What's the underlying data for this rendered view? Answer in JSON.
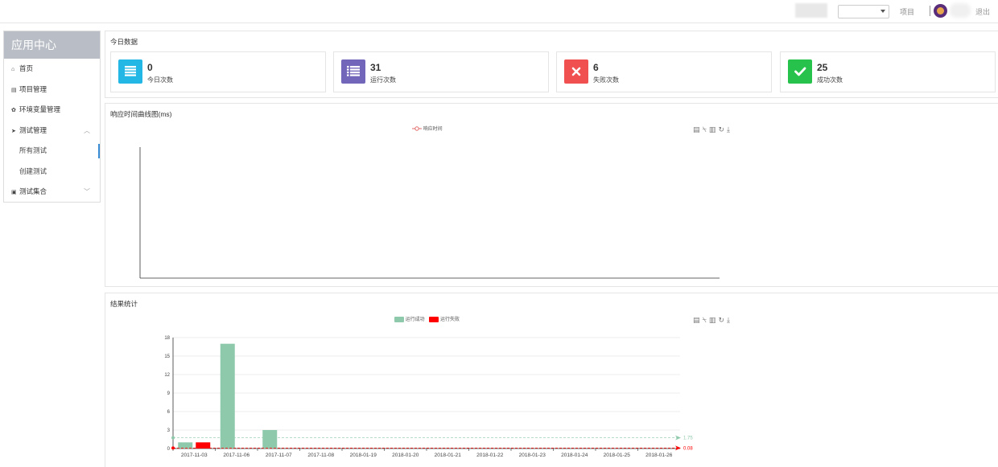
{
  "header": {
    "project_label": "项目",
    "logout_label": "退出",
    "select_value": ""
  },
  "sidebar": {
    "title": "应用中心",
    "items": [
      {
        "label": "首页",
        "icon": "home-icon"
      },
      {
        "label": "项目管理",
        "icon": "book-icon"
      },
      {
        "label": "环境变量管理",
        "icon": "gear-icon"
      },
      {
        "label": "测试管理",
        "icon": "send-icon"
      },
      {
        "label": "所有测试"
      },
      {
        "label": "创建测试"
      },
      {
        "label": "测试集合",
        "icon": "clipboard-icon"
      }
    ]
  },
  "today": {
    "title": "今日数据",
    "cards": [
      {
        "value": "0",
        "label": "今日次数",
        "color": "#23b7e5",
        "icon": "list-icon"
      },
      {
        "value": "31",
        "label": "运行次数",
        "color": "#7266ba",
        "icon": "list-icon"
      },
      {
        "value": "6",
        "label": "失败次数",
        "color": "#f05050",
        "icon": "close-icon"
      },
      {
        "value": "25",
        "label": "成功次数",
        "color": "#27c24c",
        "icon": "check-icon"
      }
    ]
  },
  "response_chart": {
    "title": "响应时间曲线图(ms)",
    "legend": "响应时间"
  },
  "result_chart": {
    "title": "结果统计"
  },
  "chart_data": [
    {
      "type": "line",
      "title": "响应时间曲线图(ms)",
      "series": [
        {
          "name": "响应时间",
          "values": []
        }
      ]
    },
    {
      "type": "bar",
      "title": "结果统计",
      "categories": [
        "2017-11-03",
        "2017-11-06",
        "2017-11-07",
        "2017-11-08",
        "2018-01-19",
        "2018-01-20",
        "2018-01-21",
        "2018-01-22",
        "2018-01-23",
        "2018-01-24",
        "2018-01-25",
        "2018-01-26"
      ],
      "series": [
        {
          "name": "运行成功",
          "color": "#8fc9ab",
          "values": [
            1,
            17,
            3,
            0,
            0,
            0,
            0,
            0,
            0,
            0,
            0,
            0
          ]
        },
        {
          "name": "运行失败",
          "color": "#ff0000",
          "values": [
            1,
            0,
            0,
            0,
            0,
            0,
            0,
            0,
            0,
            0,
            0,
            0
          ]
        }
      ],
      "yticks": [
        0,
        3,
        6,
        9,
        12,
        15,
        18
      ],
      "ylim": [
        0,
        18
      ],
      "markline_labels": [
        "1.75",
        "0.08"
      ],
      "markline_values": [
        1.75,
        0.08
      ],
      "legend_position": "top"
    }
  ]
}
